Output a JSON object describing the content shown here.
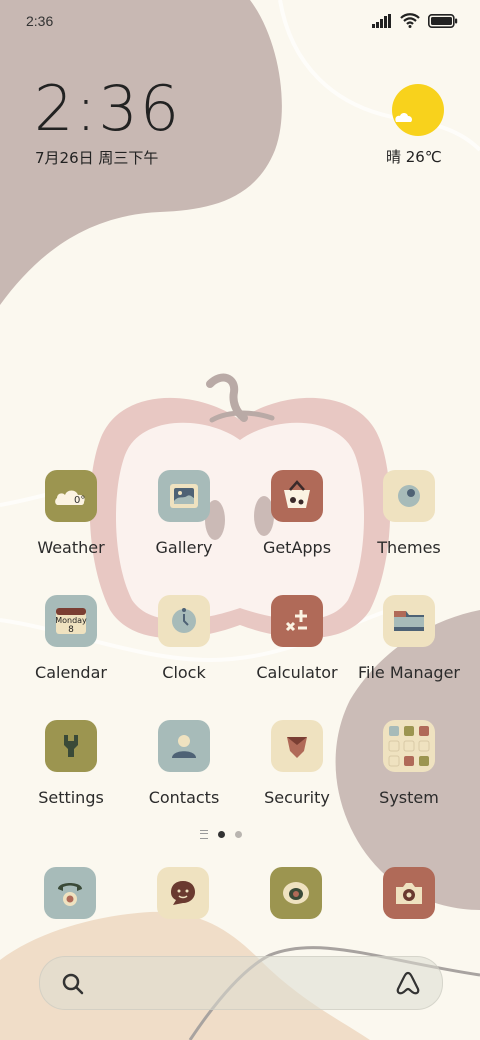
{
  "status_bar": {
    "time": "2:36"
  },
  "clock_widget": {
    "time": "2:36",
    "date": "7月26日 周三下午"
  },
  "weather_widget": {
    "text": "晴 26℃"
  },
  "apps": {
    "weather": {
      "label": "Weather",
      "badge": "0°"
    },
    "gallery": {
      "label": "Gallery"
    },
    "getapps": {
      "label": "GetApps"
    },
    "themes": {
      "label": "Themes"
    },
    "calendar": {
      "label": "Calendar",
      "day": "Monday",
      "date": "8"
    },
    "clock": {
      "label": "Clock"
    },
    "calculator": {
      "label": "Calculator"
    },
    "file_manager": {
      "label": "File Manager"
    },
    "settings": {
      "label": "Settings"
    },
    "contacts": {
      "label": "Contacts"
    },
    "security": {
      "label": "Security"
    },
    "system": {
      "label": "System"
    }
  },
  "dock": [
    "phone-icon",
    "messages-icon",
    "browser-icon",
    "camera-icon"
  ],
  "page_indicator": {
    "pages": 2,
    "current": 1
  },
  "colors": {
    "background": "#fbf8ef",
    "blob_mauve": "#c8b8b3",
    "apple_pink": "#e8c8c3",
    "sun_yellow": "#f8d21c",
    "olive": "#9c9550",
    "slate_blue": "#a7bbb9",
    "terracotta": "#b06a58",
    "cream": "#efe2c0"
  }
}
